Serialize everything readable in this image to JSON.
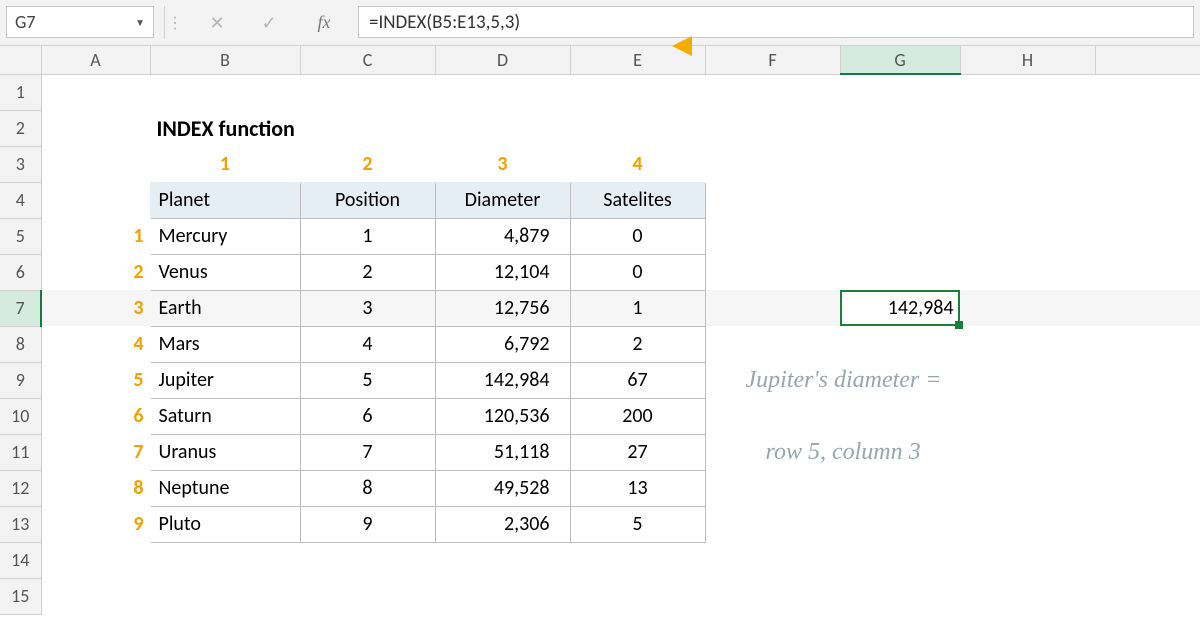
{
  "nameBox": "G7",
  "formula": "=INDEX(B5:E13,5,3)",
  "fxLabel": "fx",
  "columns": [
    "A",
    "B",
    "C",
    "D",
    "E",
    "F",
    "G",
    "H"
  ],
  "title": "INDEX function",
  "colNums": [
    "1",
    "2",
    "3",
    "4"
  ],
  "headers": {
    "b": "Planet",
    "c": "Position",
    "d": "Diameter",
    "e": "Satelites"
  },
  "rows": [
    {
      "n": "1",
      "planet": "Mercury",
      "pos": "1",
      "dia": "4,879",
      "sat": "0"
    },
    {
      "n": "2",
      "planet": "Venus",
      "pos": "2",
      "dia": "12,104",
      "sat": "0"
    },
    {
      "n": "3",
      "planet": "Earth",
      "pos": "3",
      "dia": "12,756",
      "sat": "1"
    },
    {
      "n": "4",
      "planet": "Mars",
      "pos": "4",
      "dia": "6,792",
      "sat": "2"
    },
    {
      "n": "5",
      "planet": "Jupiter",
      "pos": "5",
      "dia": "142,984",
      "sat": "67"
    },
    {
      "n": "6",
      "planet": "Saturn",
      "pos": "6",
      "dia": "120,536",
      "sat": "200"
    },
    {
      "n": "7",
      "planet": "Uranus",
      "pos": "7",
      "dia": "51,118",
      "sat": "27"
    },
    {
      "n": "8",
      "planet": "Neptune",
      "pos": "8",
      "dia": "49,528",
      "sat": "13"
    },
    {
      "n": "9",
      "planet": "Pluto",
      "pos": "9",
      "dia": "2,306",
      "sat": "5"
    }
  ],
  "result": "142,984",
  "annotation1": "Jupiter's diameter =",
  "annotation2": "row 5, column 3",
  "rowLabels": [
    "1",
    "2",
    "3",
    "4",
    "5",
    "6",
    "7",
    "8",
    "9",
    "10",
    "11",
    "12",
    "13",
    "14",
    "15"
  ]
}
